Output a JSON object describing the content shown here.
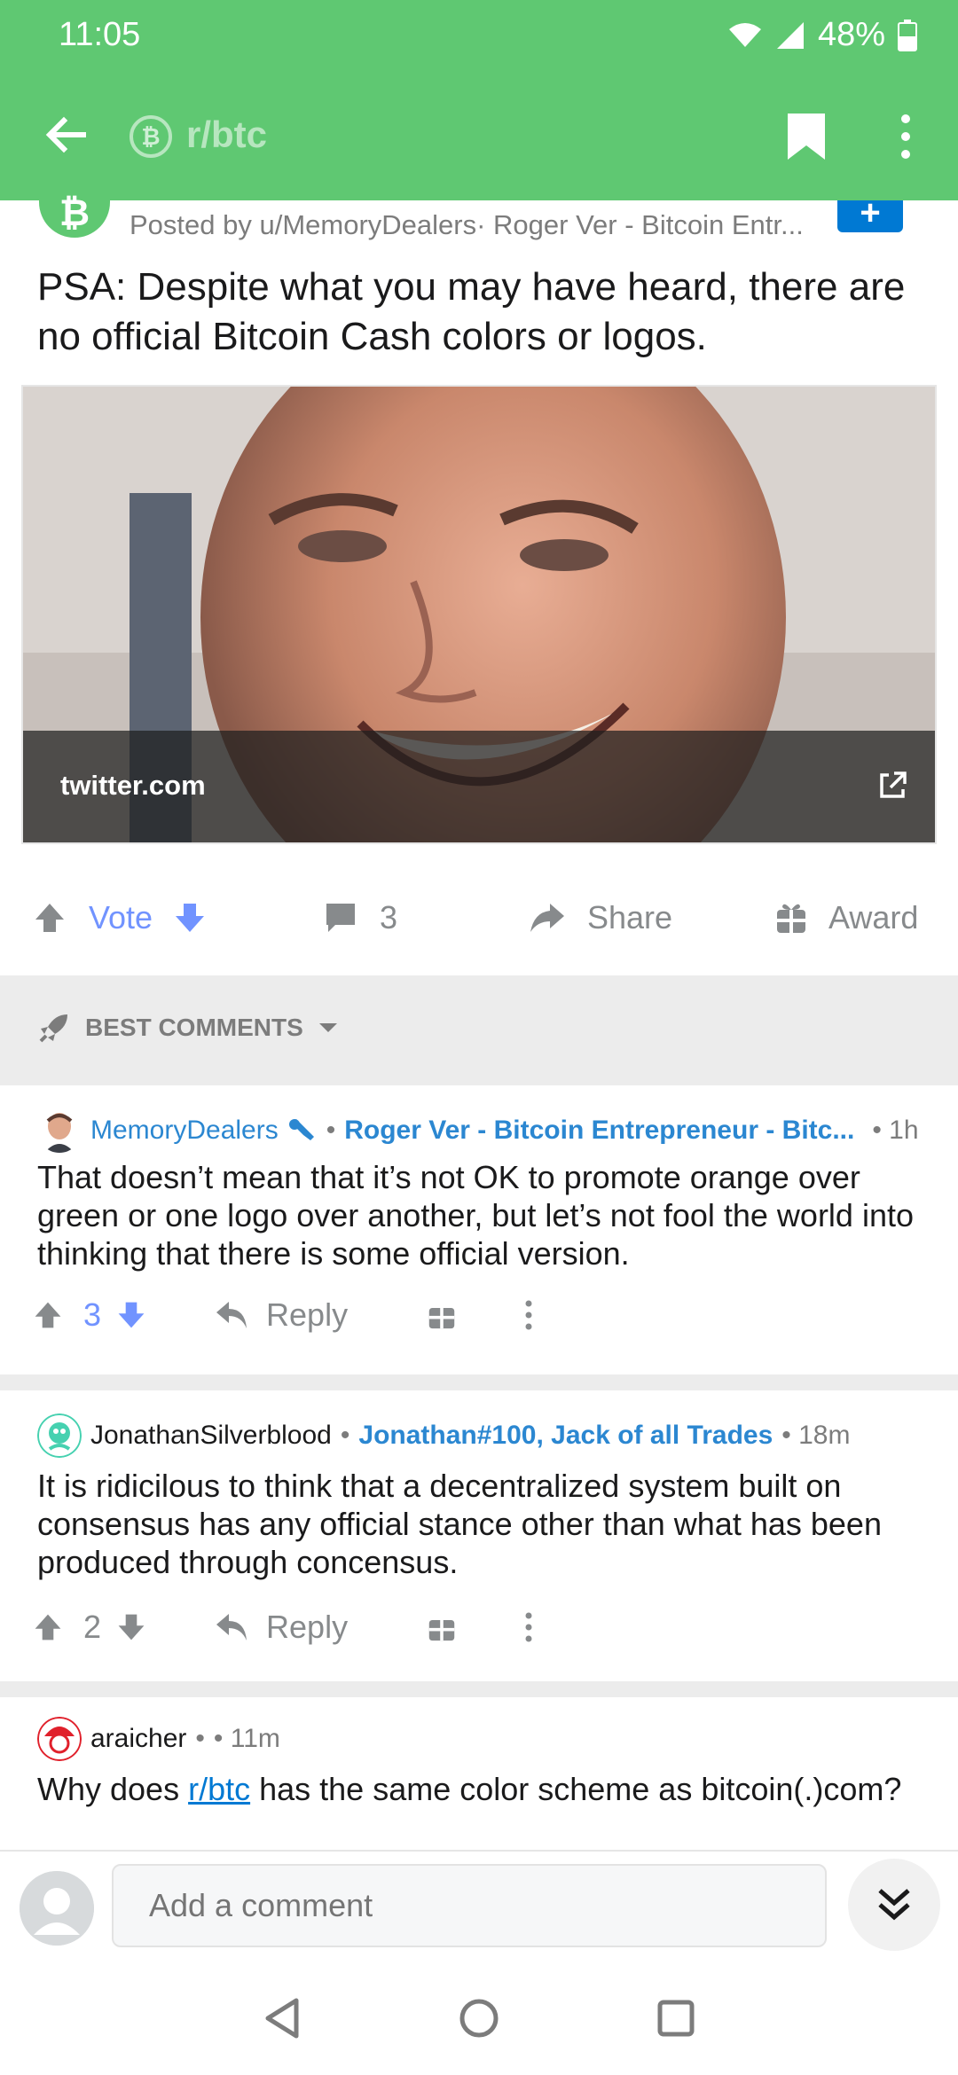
{
  "colors": {
    "brand": "#5fc872",
    "flair": "#2b87d1",
    "vote": "#7193ff"
  },
  "status_bar": {
    "time": "11:05",
    "battery": "48%"
  },
  "header": {
    "subreddit": "r/btc",
    "sub_icon_glyph": "₿",
    "back_icon": "arrow-left-icon",
    "bookmark_icon": "bookmark-icon",
    "more_icon": "more-vertical-icon"
  },
  "post": {
    "avatar_glyph": "₿",
    "join_glyph": "+",
    "posted_by": "Posted by u/MemoryDealers· Roger Ver - Bitcoin Entr...",
    "title": "PSA: Despite what you may have heard, there are no official Bitcoin Cash colors or logos.",
    "preview_domain": "twitter.com"
  },
  "actions": {
    "vote": "Vote",
    "comments": "3",
    "share": "Share",
    "award": "Award"
  },
  "sort": {
    "label": "BEST COMMENTS"
  },
  "comments": [
    {
      "author": "MemoryDealers",
      "dot": "•",
      "flair": "Roger Ver - Bitcoin Entrepreneur - Bitc...",
      "time": "• 1h",
      "body": "That doesn’t mean that it’s not OK to promote orange over green or one logo over another, but let’s not fool the world into thinking that there is some official version.",
      "score": "3",
      "reply": "Reply"
    },
    {
      "author": "JonathanSilverblood",
      "dot": "•",
      "flair": "Jonathan#100, Jack of all Trades",
      "time": "• 18m",
      "body": "It is ridicilous to think that a decentralized system built on consensus has any official stance other than what has been produced through concensus.",
      "score": "2",
      "reply": "Reply"
    },
    {
      "author": "araicher",
      "dot": "•",
      "time": "• 11m",
      "body_before": "Why does ",
      "body_link": "r/btc",
      "body_after": " has the same color scheme as bitcoin(.)com?"
    }
  ],
  "composer": {
    "placeholder": "Add a comment"
  }
}
